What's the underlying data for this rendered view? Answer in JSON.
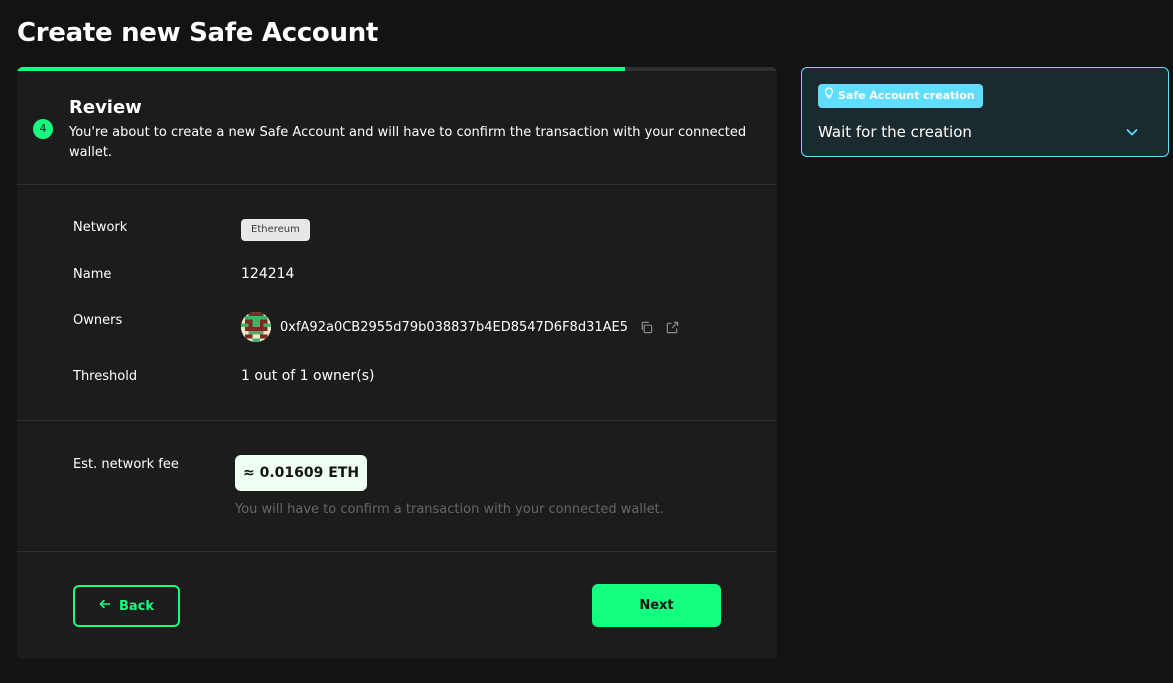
{
  "page": {
    "title": "Create new Safe Account"
  },
  "progress": {
    "fraction": 0.8
  },
  "step": {
    "number": "4",
    "title": "Review",
    "description": "You're about to create a new Safe Account and will have to confirm the transaction with your connected wallet."
  },
  "details": {
    "network_label": "Network",
    "network_value": "Ethereum",
    "name_label": "Name",
    "name_value": "124214",
    "owners_label": "Owners",
    "owner_address": "0xfA92a0CB2955d79b038837b4ED8547D6F8d31AE5",
    "threshold_label": "Threshold",
    "threshold_value": "1 out of 1 owner(s)"
  },
  "fee": {
    "label": "Est. network fee",
    "value": "≈ 0.01609 ETH",
    "hint": "You will have to confirm a transaction with your connected wallet."
  },
  "actions": {
    "back_label": "Back",
    "next_label": "Next"
  },
  "side_panel": {
    "tag": "Safe Account creation",
    "title": "Wait for the creation"
  },
  "colors": {
    "accent": "#12ff80",
    "info": "#5fddff",
    "background": "#121312",
    "card": "#1c1c1c"
  },
  "icons": {
    "step": "step-number-badge",
    "owner": "identicon-avatar",
    "copy": "copy-icon",
    "explorer": "external-link-icon",
    "back": "arrow-left-icon",
    "tag": "lightbulb-icon",
    "expand": "chevron-down-icon"
  }
}
